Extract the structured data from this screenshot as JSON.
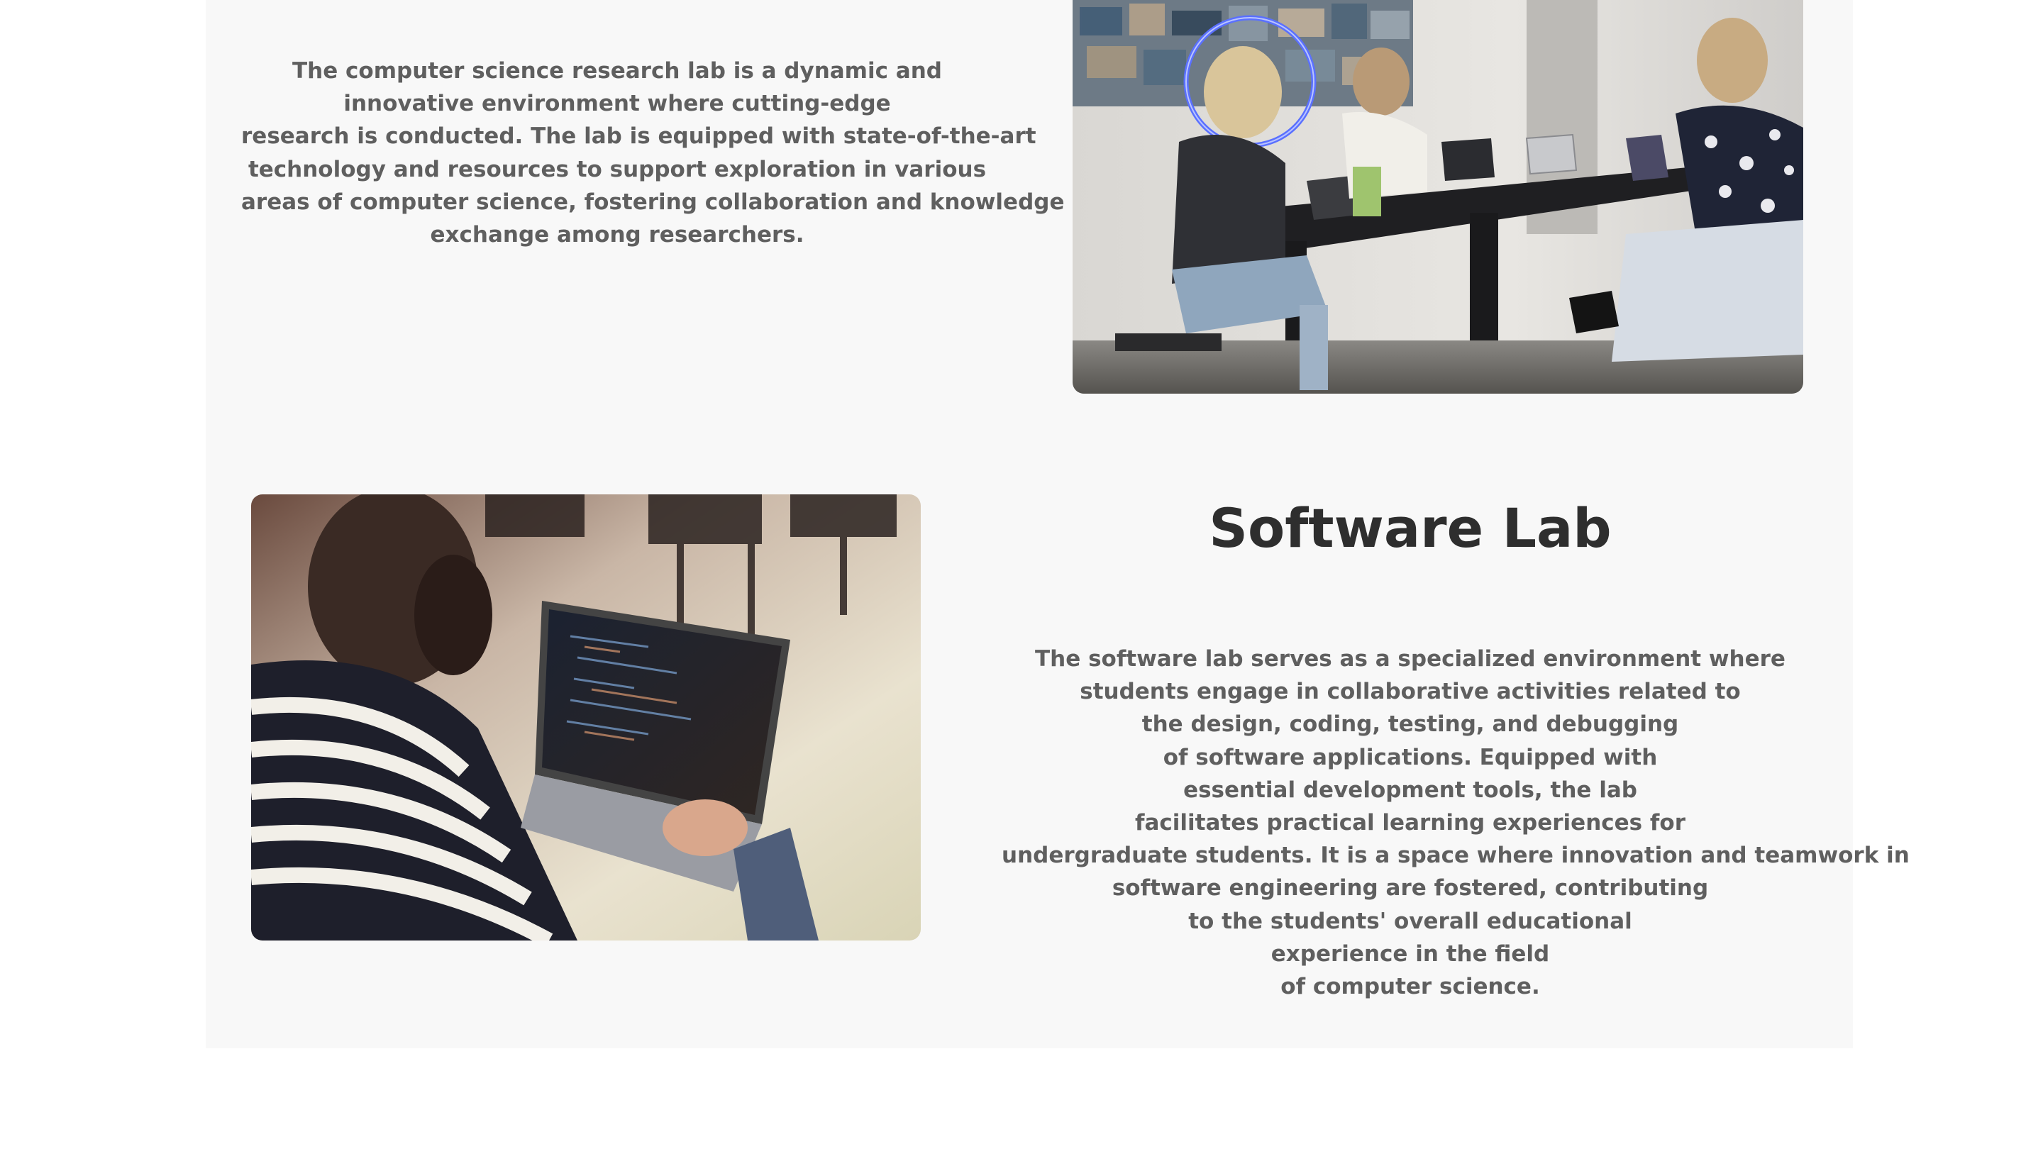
{
  "research_lab": {
    "description_lines": [
      "The computer science research lab is a dynamic and",
      "innovative environment where cutting-edge",
      "research is conducted. The lab is equipped with state-of-the-art",
      "technology and resources to support exploration in various",
      "areas of computer science, fostering collaboration and knowledge",
      "exchange among researchers."
    ],
    "image": "research-lab-photo"
  },
  "software_lab": {
    "title": "Software Lab",
    "description_lines": [
      "The software lab serves as a specialized environment where",
      "students engage in collaborative activities related to",
      "the design, coding, testing, and debugging",
      "of software applications. Equipped with",
      "essential development tools, the lab",
      "facilitates practical learning experiences for",
      "undergraduate students. It is a space where innovation and teamwork in",
      "software engineering are fostered, contributing",
      "to the students' overall educational",
      "experience in the field",
      "of computer science."
    ],
    "image": "software-lab-photo"
  }
}
